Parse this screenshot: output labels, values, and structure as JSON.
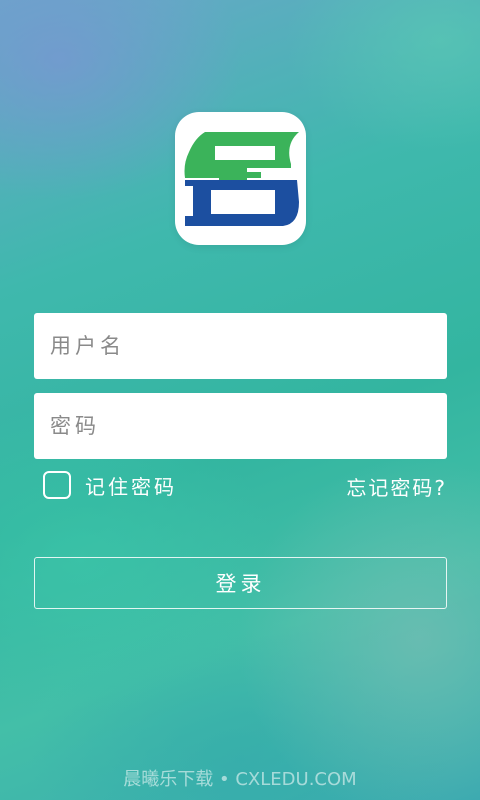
{
  "logo": {
    "name": "app-logo",
    "green": "#3bb35a",
    "blue": "#1c4fa0"
  },
  "form": {
    "username_placeholder": "用户名",
    "username_value": "",
    "password_placeholder": "密码",
    "password_value": "",
    "remember_label": "记住密码",
    "remember_checked": false,
    "forgot_label": "忘记密码?",
    "login_label": "登录"
  },
  "footer": {
    "watermark": "晨曦乐下载 • CXLEDU.COM"
  },
  "colors": {
    "background": "#3fb8ad",
    "input_bg": "#ffffff",
    "text_light": "#ffffff"
  }
}
